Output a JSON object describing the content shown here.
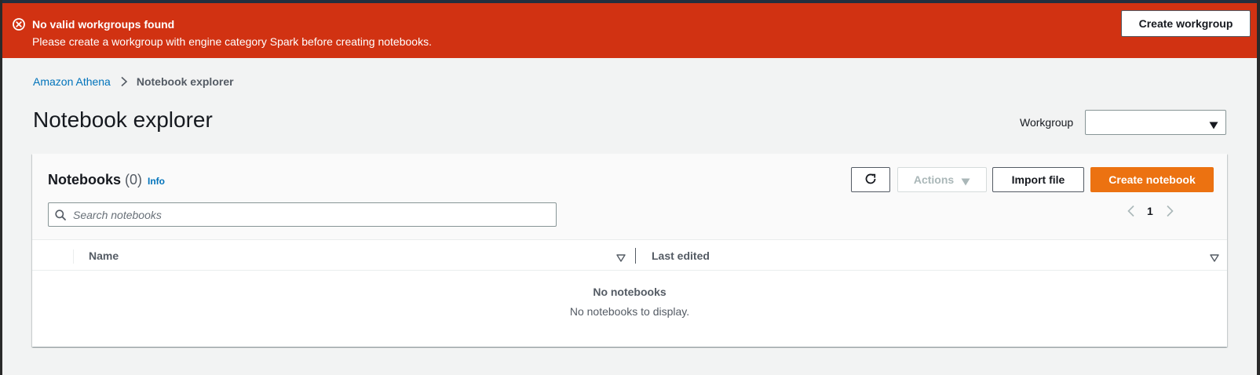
{
  "alert": {
    "title": "No valid workgroups found",
    "message": "Please create a workgroup with engine category Spark before creating notebooks.",
    "button_label": "Create workgroup",
    "color": "#d13212"
  },
  "breadcrumb": {
    "root": "Amazon Athena",
    "current": "Notebook explorer"
  },
  "page": {
    "title": "Notebook explorer"
  },
  "workgroup": {
    "label": "Workgroup",
    "selected": ""
  },
  "notebooks": {
    "title": "Notebooks",
    "count": "(0)",
    "info_label": "Info",
    "actions_label": "Actions",
    "import_label": "Import file",
    "create_label": "Create notebook",
    "search_placeholder": "Search notebooks",
    "current_page": "1",
    "columns": [
      "Name",
      "Last edited"
    ],
    "empty_title": "No notebooks",
    "empty_message": "No notebooks to display."
  },
  "colors": {
    "primary_button": "#ec7211",
    "link": "#0073bb"
  },
  "icons": {
    "alert": "error-circle-icon",
    "refresh": "refresh-icon",
    "search": "search-icon",
    "dropdown": "caret-down-icon",
    "pager_prev": "chevron-left-icon",
    "pager_next": "chevron-right-icon",
    "sort": "sort-caret-icon",
    "breadcrumb_separator": "chevron-right-icon"
  }
}
